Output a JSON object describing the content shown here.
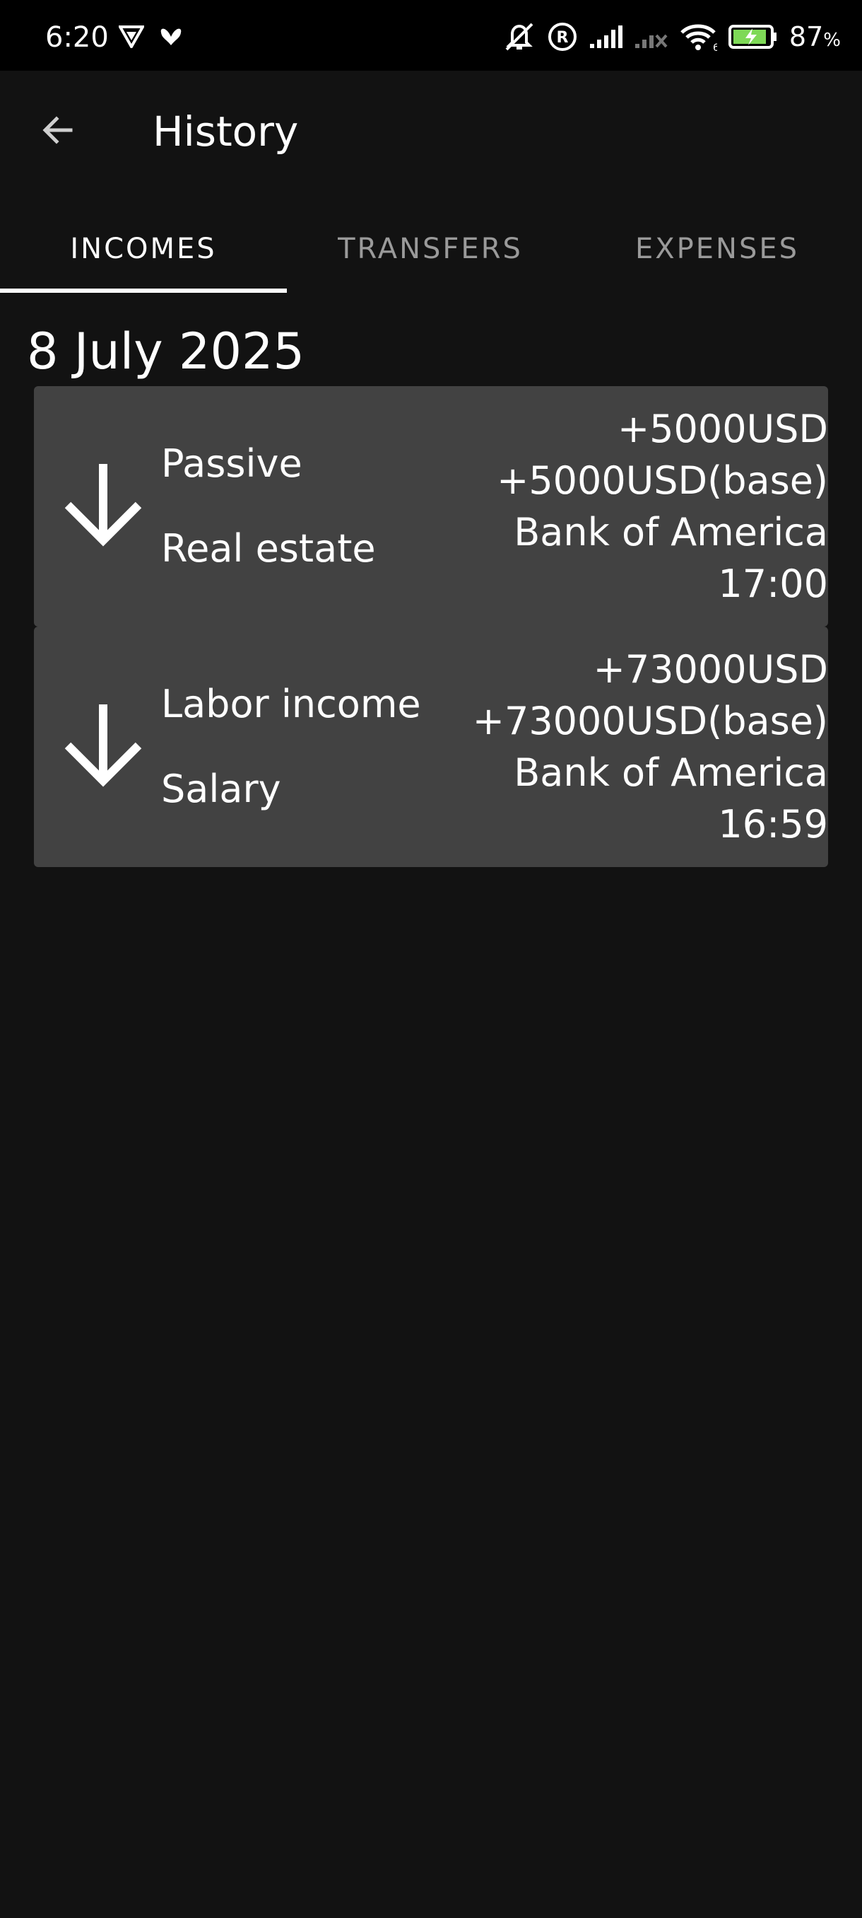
{
  "status_bar": {
    "time": "6:20",
    "battery_percent": "87",
    "battery_unit": "%",
    "icons_left": [
      "shield-app-icon",
      "butterfly-app-icon"
    ],
    "icons_right": [
      "bell-muted-icon",
      "registered-icon",
      "signal-icon",
      "signal-off-icon",
      "wifi-icon",
      "battery-charging-icon"
    ]
  },
  "app_bar": {
    "title": "History",
    "back_icon": "arrow-left-icon"
  },
  "tabs": [
    {
      "label": "INCOMES",
      "active": true
    },
    {
      "label": "TRANSFERS",
      "active": false
    },
    {
      "label": "EXPENSES",
      "active": false
    }
  ],
  "date_header": "8 July 2025",
  "transactions": [
    {
      "icon": "arrow-down-icon",
      "category": "Passive",
      "subcategory": "Real estate",
      "amount": "+5000USD",
      "amount_base": "+5000USD(base)",
      "account": "Bank of America",
      "time": "17:00"
    },
    {
      "icon": "arrow-down-icon",
      "category": "Labor income",
      "subcategory": "Salary",
      "amount": "+73000USD",
      "amount_base": "+73000USD(base)",
      "account": "Bank of America",
      "time": "16:59"
    }
  ],
  "colors": {
    "background": "#121212",
    "status_bar": "#000000",
    "card": "#424242",
    "tab_inactive": "#9a9a9a",
    "battery_charge": "#7ed957"
  }
}
